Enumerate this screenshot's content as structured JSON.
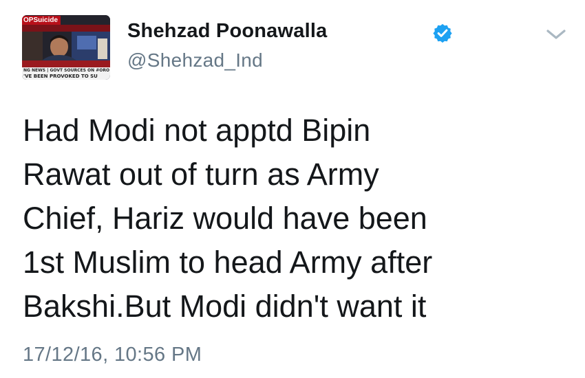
{
  "profile": {
    "display_name": "Shehzad Poonawalla",
    "handle": "@Shehzad_Ind",
    "verified": true,
    "avatar": {
      "tag_text": "OPSuicide",
      "ticker_line_1": "NG NEWS | GOVT SOURCES ON #ORO",
      "ticker_line_2": "'VE BEEN PROVOKED TO SU"
    }
  },
  "tweet": {
    "lines": [
      "Had Modi not apptd Bipin",
      "Rawat out of turn as Army",
      "Chief, Hariz would have been",
      "1st Muslim to head Army after",
      "Bakshi.But Modi didn't want it"
    ],
    "timestamp": "17/12/16, 10:56 PM"
  },
  "icons": {
    "verified": "verified-badge-icon",
    "menu": "chevron-down-icon"
  },
  "colors": {
    "text_primary": "#14171a",
    "text_secondary": "#657786",
    "verified_blue": "#1da1f2",
    "chevron": "#aab8c2"
  }
}
